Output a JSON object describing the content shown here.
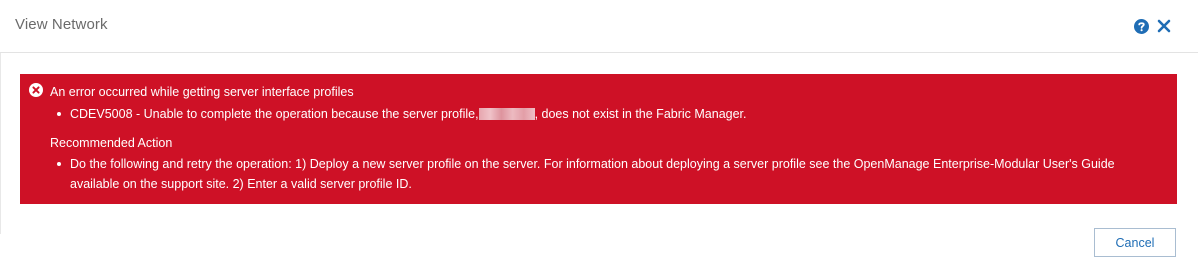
{
  "dialog": {
    "title": "View Network",
    "help_icon": "help-circle-icon",
    "close_icon": "close-icon"
  },
  "error": {
    "icon": "error-circle-x-icon",
    "heading": "An error occurred while getting server interface profiles",
    "message_prefix": "CDEV5008 - Unable to complete the operation because the server profile,",
    "message_suffix": ", does not exist in the Fabric Manager.",
    "recommended_heading": "Recommended Action",
    "recommended_items": [
      "Do the following and retry the operation: 1) Deploy a new server profile on the server. For information about deploying a server profile see the OpenManage Enterprise-Modular User's Guide available on the support site. 2) Enter a valid server profile ID."
    ]
  },
  "footer": {
    "cancel_label": "Cancel"
  },
  "colors": {
    "error_background": "#ce1126",
    "accent": "#1f6db5"
  }
}
